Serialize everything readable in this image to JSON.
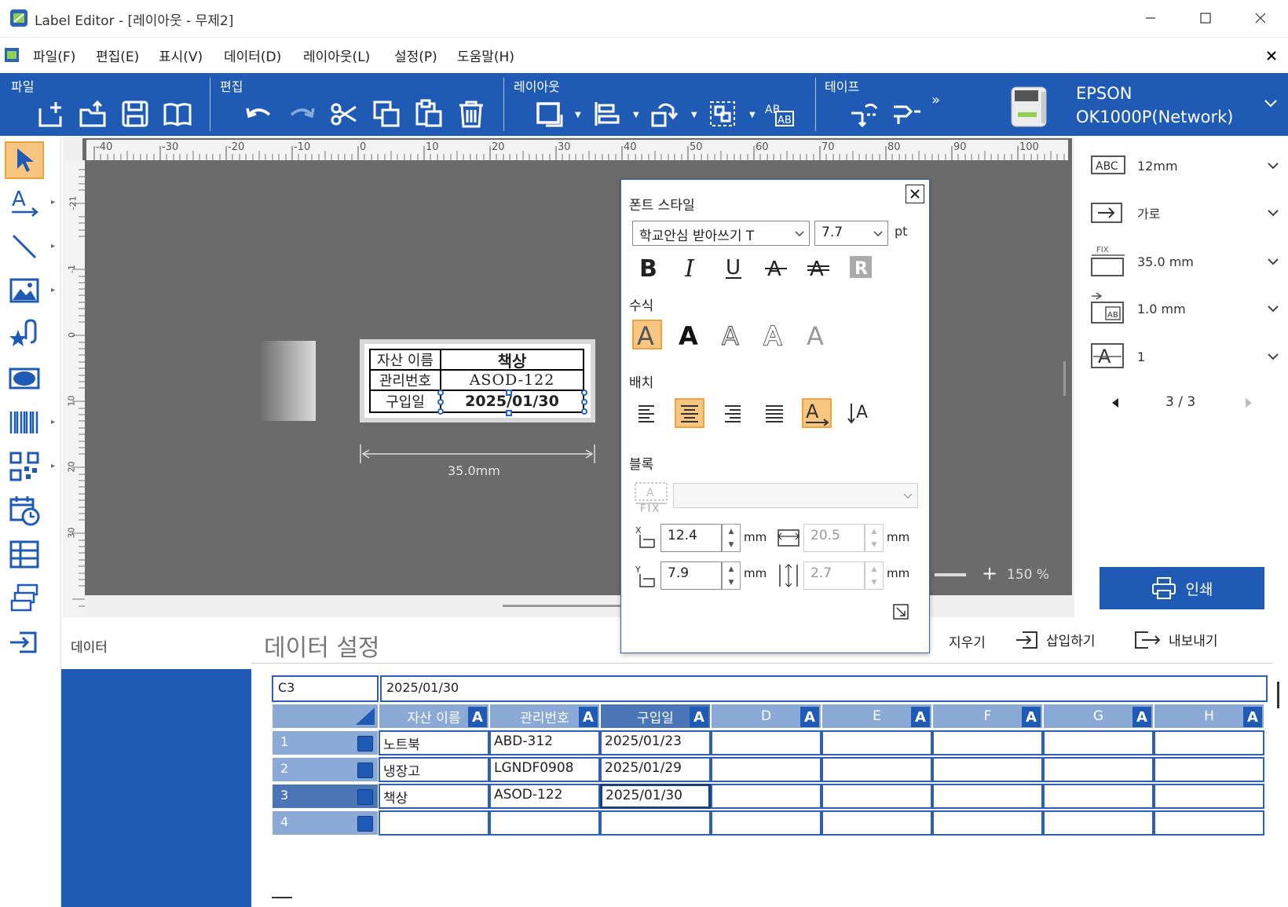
{
  "window": {
    "title": "Label Editor - [레이아웃 - 무제2]"
  },
  "menu": [
    "파일(F)",
    "편집(E)",
    "표시(V)",
    "데이터(D)",
    "레이아웃(L)",
    "설정(P)",
    "도움말(H)"
  ],
  "ribbon": {
    "groups": {
      "file": "파일",
      "edit": "편집",
      "layout": "레이아웃",
      "tape": "테이프"
    },
    "more": "»",
    "printer": {
      "line1": "EPSON",
      "line2": "OK1000P(Network)"
    }
  },
  "ruler": {
    "ticks": [
      "-40",
      "-30",
      "-20",
      "-10",
      "0",
      "10",
      "20",
      "30",
      "40",
      "50",
      "60",
      "70",
      "80",
      "90",
      "100"
    ],
    "left_ticks": [
      "-21",
      "-1",
      "0",
      "10",
      "20",
      "30"
    ]
  },
  "label": {
    "rows": [
      {
        "header": "자산 이름",
        "value": "책상"
      },
      {
        "header": "관리번호",
        "value": "ASOD-122"
      },
      {
        "header": "구입일",
        "value": "2025/01/30"
      }
    ],
    "dimension": "35.0mm"
  },
  "zoom": {
    "plus": "+",
    "value": "150 %"
  },
  "right_panel": {
    "tape_width": "12mm",
    "orientation": "가로",
    "length": "35.0 mm",
    "margin": "1.0 mm",
    "copies": "1",
    "page": "3 / 3",
    "print_button": "인쇄"
  },
  "font_popup": {
    "section_font": "폰트 스타일",
    "font_name": "학교안심 받아쓰기 T",
    "font_size": "7.7",
    "unit_pt": "pt",
    "section_decor": "수식",
    "section_align": "배치",
    "section_block": "블록",
    "fix_label": "FIX",
    "x": "12.4",
    "y": "7.9",
    "width": "20.5",
    "height": "2.7",
    "unit_mm": "mm"
  },
  "data_area": {
    "sidebar_title": "데이터",
    "title": "데이터 설정",
    "actions": {
      "clear": "지우기",
      "insert": "삽입하기",
      "export": "내보내기"
    },
    "cell_ref": "C3",
    "cell_value": "2025/01/30",
    "columns": [
      "자산 이름",
      "관리번호",
      "구입일",
      "D",
      "E",
      "F",
      "G",
      "H"
    ],
    "column_badge": "A",
    "rows": [
      {
        "num": "1",
        "cells": [
          "노트북",
          "ABD-312",
          "2025/01/23"
        ]
      },
      {
        "num": "2",
        "cells": [
          "냉장고",
          "LGNDF0908",
          "2025/01/29"
        ]
      },
      {
        "num": "3",
        "cells": [
          "책상",
          "ASOD-122",
          "2025/01/30"
        ]
      },
      {
        "num": "4",
        "cells": [
          "",
          "",
          ""
        ]
      }
    ]
  }
}
